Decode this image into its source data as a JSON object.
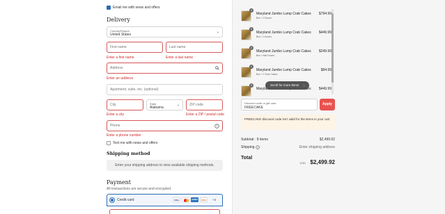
{
  "contact": {
    "email_news_label": "Email me with news and offers"
  },
  "delivery": {
    "heading": "Delivery",
    "country_label": "Country/Region",
    "country_value": "United States",
    "first_name_placeholder": "First name",
    "first_name_error": "Enter a first name",
    "last_name_placeholder": "Last name",
    "last_name_error": "Enter a last name",
    "address_placeholder": "Address",
    "address_error": "Enter an address",
    "apartment_placeholder": "Apartment, suite, etc. (optional)",
    "city_placeholder": "City",
    "city_error": "Enter a city",
    "state_label": "State",
    "state_value": "Alabama",
    "zip_placeholder": "ZIP code",
    "zip_error": "Enter a ZIP / postal code",
    "phone_placeholder": "Phone",
    "phone_error": "Enter a phone number",
    "text_news_label": "Text me with news and offers"
  },
  "shipping": {
    "heading": "Shipping method",
    "info": "Enter your shipping address to view available shipping methods."
  },
  "payment": {
    "heading": "Payment",
    "subtitle": "All transactions are secure and encrypted.",
    "credit_card_label": "Credit card",
    "cards": [
      "VISA",
      "MC",
      "AMEX",
      "DISC"
    ],
    "more_cards": "+4"
  },
  "cart": {
    "items": [
      {
        "qty": "4",
        "name": "Maryland Jumbo Lump Crab Cakes",
        "variant": "Box / 2 Dozen",
        "price": "$794.99"
      },
      {
        "qty": "3",
        "name": "Maryland Jumbo Lump Crab Cakes",
        "variant": "Box / 1 Dozen",
        "price": "$449.99"
      },
      {
        "qty": "2",
        "name": "Maryland Jumbo Lump Crab Cakes",
        "variant": "Box / Half Dozen",
        "price": "$249.99"
      },
      {
        "qty": "1",
        "name": "Maryland Jumbo Lump Crab Cakes",
        "variant": "Box / 2 Crab Cakes",
        "price": "$94.99"
      },
      {
        "qty": "3",
        "name": "Maryland Jumbo Lump Crab Cakes",
        "variant": "",
        "price": "$449.99"
      }
    ],
    "scroll_hint": "Scroll for more items",
    "discount_label": "Discount code or gift card",
    "discount_value": "FREECAKE",
    "apply_label": "Apply",
    "discount_warning": "FREECAKE discount code isn't valid for the items in your cart",
    "subtotal_label": "Subtotal · 8 items",
    "subtotal_value": "$2,499.92",
    "shipping_label": "Shipping",
    "shipping_value": "Enter shipping address",
    "total_label": "Total",
    "currency": "USD",
    "total_value": "$2,499.92"
  },
  "colors": {
    "accent": "#2a6db5",
    "error": "#d12c2c",
    "apply": "#e8524f",
    "warn_bg": "#fdf4e6"
  }
}
